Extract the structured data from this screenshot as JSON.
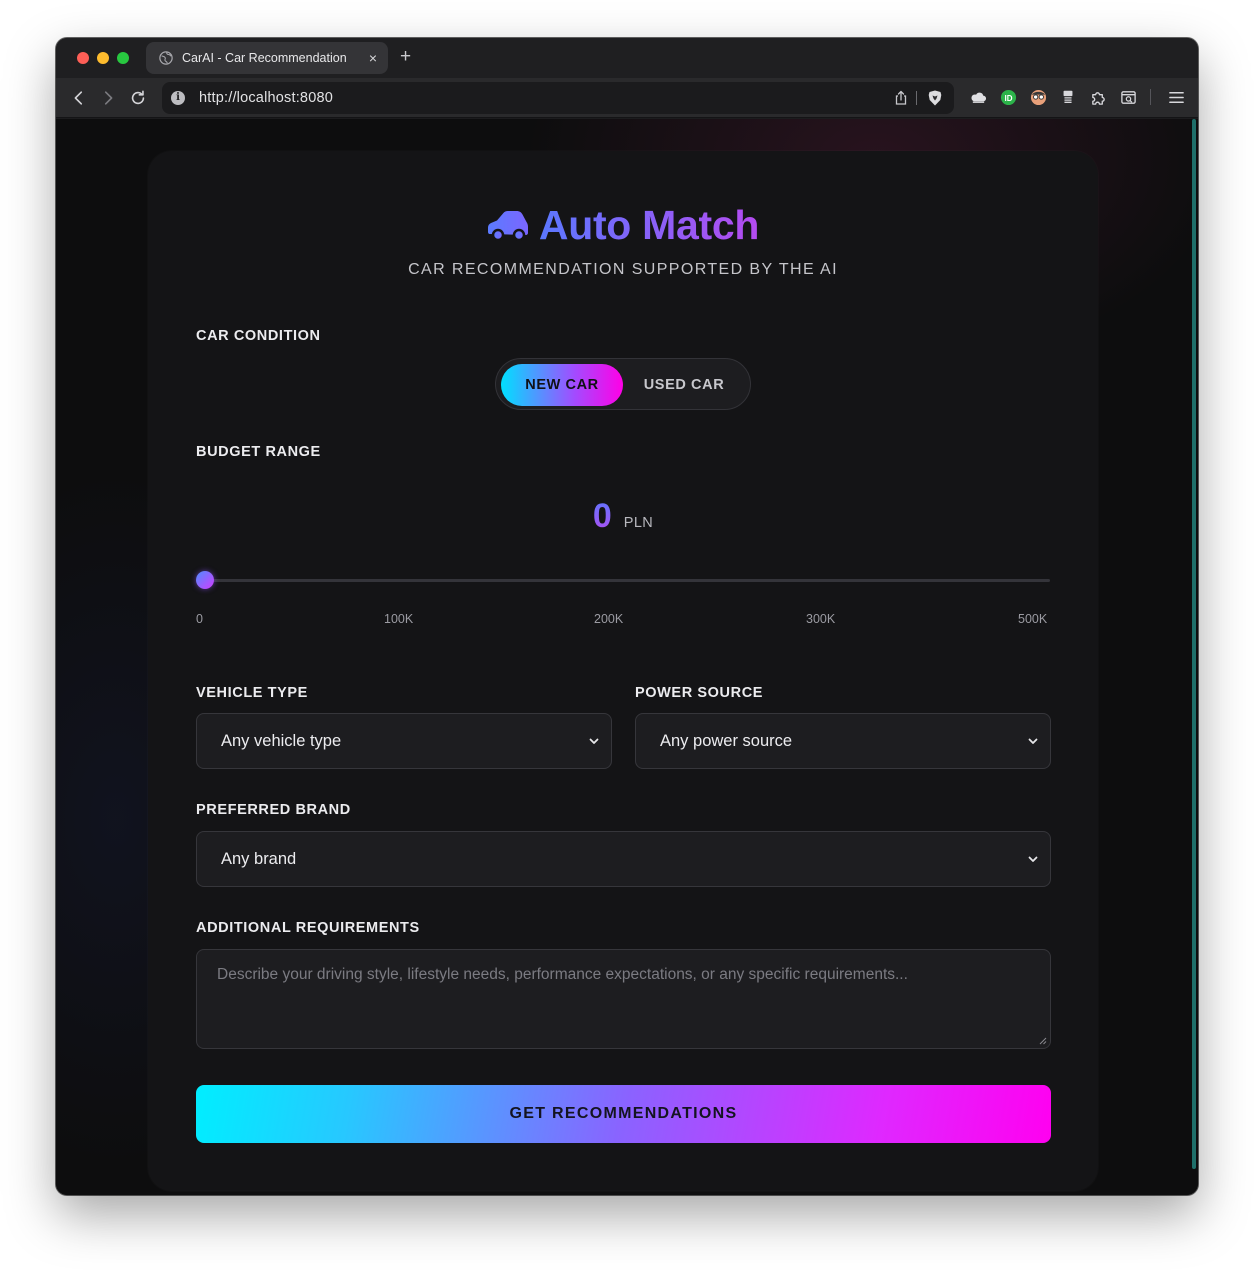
{
  "browser": {
    "tab_title": "CarAI - Car Recommendation",
    "tab_close": "×",
    "new_tab": "+",
    "url": "http://localhost:8080"
  },
  "app": {
    "title": "Auto Match",
    "subtitle": "CAR RECOMMENDATION SUPPORTED BY THE AI",
    "accent_from": "#5b78ff",
    "accent_to": "#b54bf0"
  },
  "condition": {
    "label": "CAR CONDITION",
    "options": [
      "NEW CAR",
      "USED CAR"
    ],
    "selected": "NEW CAR"
  },
  "budget": {
    "label": "BUDGET RANGE",
    "value": "0",
    "currency": "PLN",
    "ticks": [
      "0",
      "100K",
      "200K",
      "300K",
      "500K"
    ]
  },
  "vehicle_type": {
    "label": "VEHICLE TYPE",
    "selected": "Any vehicle type"
  },
  "power_source": {
    "label": "POWER SOURCE",
    "selected": "Any power source"
  },
  "brand": {
    "label": "PREFERRED BRAND",
    "selected": "Any brand"
  },
  "requirements": {
    "label": "ADDITIONAL REQUIREMENTS",
    "placeholder": "Describe your driving style, lifestyle needs, performance expectations, or any specific requirements..."
  },
  "submit_label": "GET RECOMMENDATIONS"
}
